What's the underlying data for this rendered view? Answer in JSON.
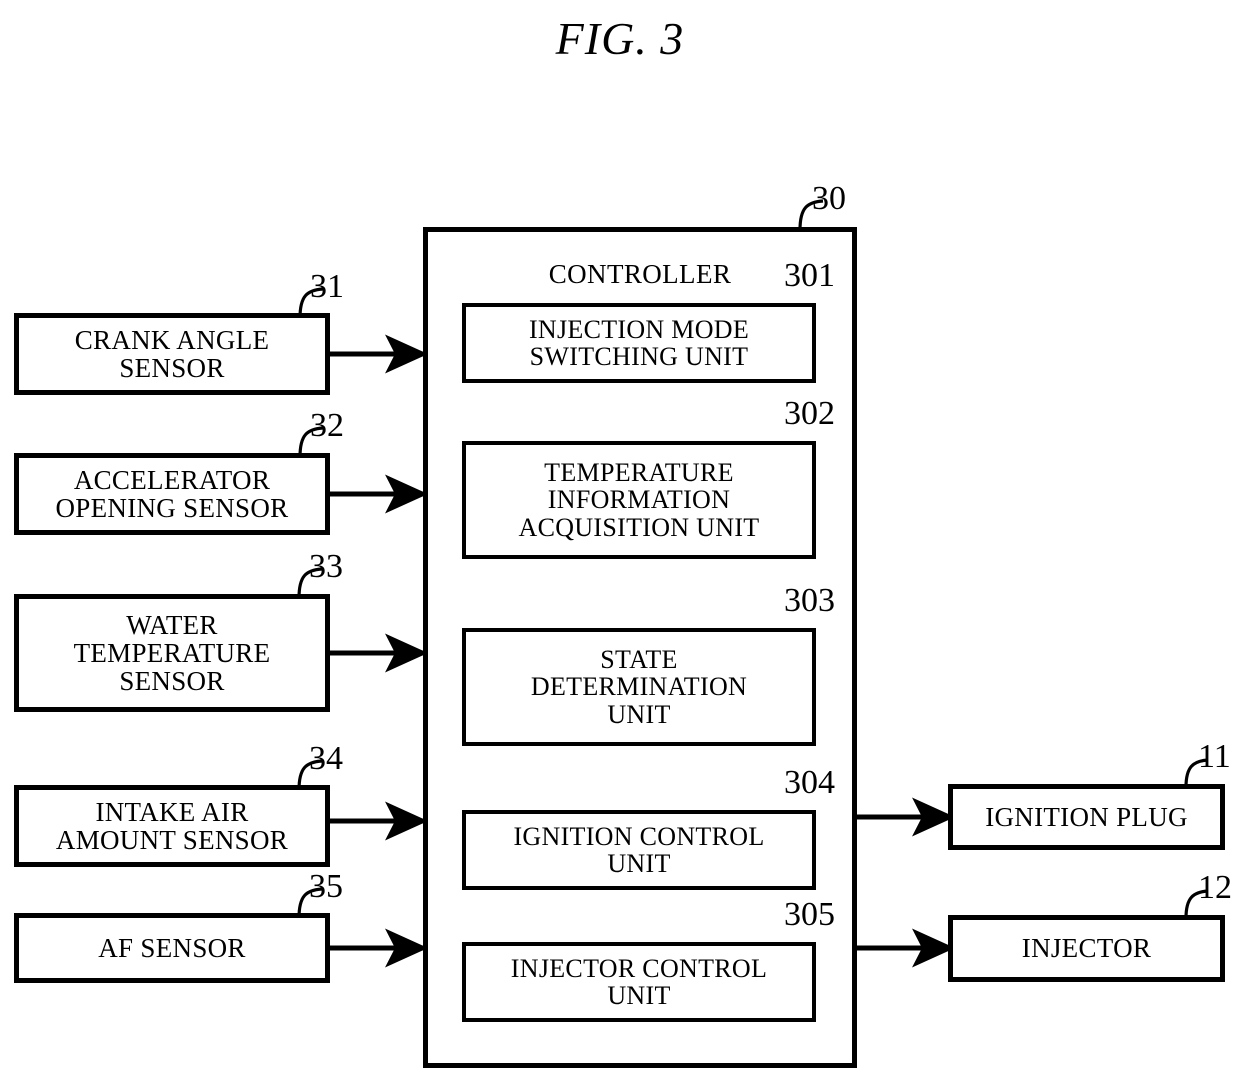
{
  "figure": {
    "title": "FIG. 3",
    "type": "block-diagram",
    "background_color": "#ffffff",
    "line_color": "#000000"
  },
  "controller": {
    "label": "CONTROLLER",
    "ref": "30",
    "units": [
      {
        "ref": "301",
        "label": "INJECTION MODE\nSWITCHING UNIT"
      },
      {
        "ref": "302",
        "label": "TEMPERATURE\nINFORMATION\nACQUISITION UNIT"
      },
      {
        "ref": "303",
        "label": "STATE\nDETERMINATION\nUNIT"
      },
      {
        "ref": "304",
        "label": "IGNITION CONTROL\nUNIT"
      },
      {
        "ref": "305",
        "label": "INJECTOR CONTROL\nUNIT"
      }
    ]
  },
  "inputs": [
    {
      "ref": "31",
      "label": "CRANK ANGLE\nSENSOR"
    },
    {
      "ref": "32",
      "label": "ACCELERATOR\nOPENING SENSOR"
    },
    {
      "ref": "33",
      "label": "WATER\nTEMPERATURE\nSENSOR"
    },
    {
      "ref": "34",
      "label": "INTAKE AIR\nAMOUNT SENSOR"
    },
    {
      "ref": "35",
      "label": "AF SENSOR"
    }
  ],
  "outputs": [
    {
      "ref": "11",
      "label": "IGNITION PLUG"
    },
    {
      "ref": "12",
      "label": "INJECTOR"
    }
  ]
}
